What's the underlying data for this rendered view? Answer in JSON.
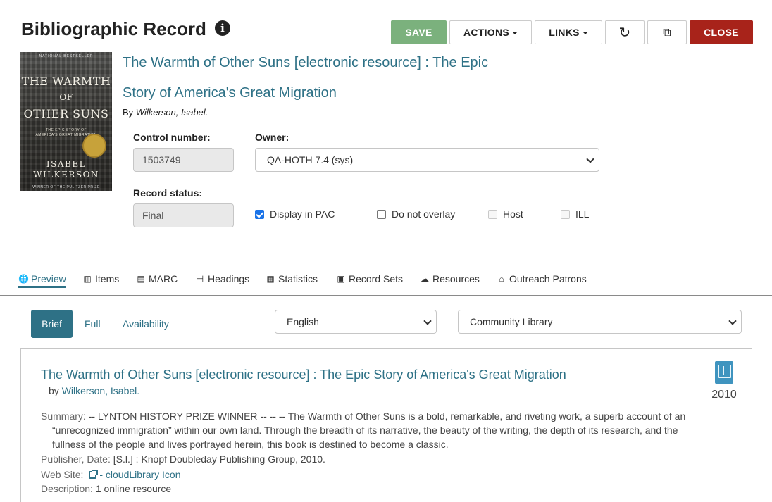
{
  "header": {
    "title": "Bibliographic Record",
    "info_glyph": "i"
  },
  "toolbar": {
    "save_label": "SAVE",
    "actions_label": "ACTIONS",
    "links_label": "LINKS",
    "refresh_glyph": "↻",
    "popout_glyph": "⧉",
    "close_label": "CLOSE"
  },
  "cover": {
    "top_text": "NATIONAL BESTSELLER",
    "title_line1": "THE WARMTH",
    "title_line2": "OF",
    "title_line3": "OTHER SUNS",
    "subtitle_line1": "THE EPIC STORY OF",
    "subtitle_line2": "AMERICA'S GREAT MIGRATION",
    "author_line1": "ISABEL",
    "author_line2": "WILKERSON",
    "footer_text": "WINNER OF THE PULITZER PRIZE"
  },
  "record": {
    "title": "The Warmth of Other Suns [electronic resource] : The Epic Story of America's Great Migration",
    "by_prefix": "By ",
    "author": "Wilkerson, Isabel."
  },
  "fields": {
    "control_number_label": "Control number:",
    "control_number_value": "1503749",
    "owner_label": "Owner:",
    "owner_value": "QA-HOTH 7.4 (sys)",
    "record_status_label": "Record status:",
    "record_status_value": "Final"
  },
  "checkboxes": {
    "display_in_pac": "Display in PAC",
    "do_not_overlay": "Do not overlay",
    "host": "Host",
    "ill": "ILL"
  },
  "tabs": [
    {
      "label": "Preview",
      "icon": "🌐"
    },
    {
      "label": "Items",
      "icon": "▥"
    },
    {
      "label": "MARC",
      "icon": "▤"
    },
    {
      "label": "Headings",
      "icon": "⊣"
    },
    {
      "label": "Statistics",
      "icon": "▦"
    },
    {
      "label": "Record Sets",
      "icon": "▣"
    },
    {
      "label": "Resources",
      "icon": "☁"
    },
    {
      "label": "Outreach Patrons",
      "icon": "⌂"
    }
  ],
  "subtabs": {
    "brief": "Brief",
    "full": "Full",
    "availability": "Availability"
  },
  "selects": {
    "language": "English",
    "library": "Community Library"
  },
  "preview": {
    "title": "The Warmth of Other Suns [electronic resource] : The Epic Story of America's Great Migration",
    "by_prefix": "by ",
    "author": "Wilkerson, Isabel.",
    "year": "2010",
    "summary_label": "Summary: ",
    "summary_line1": "-- LYNTON HISTORY PRIZE WINNER --     -- -- The Warmth of Other Suns is a bold, remarkable, and riveting work, a superb account of an",
    "summary_line2": "“unrecognized immigration” within our own land. Through the breadth of its narrative, the beauty of the writing, the depth of its research, and the",
    "summary_line3": "fullness of the people and lives portrayed herein, this book is destined to become a classic.",
    "publisher_label": "Publisher, Date: ",
    "publisher_value": "[S.l.] : Knopf Doubleday Publishing Group, 2010.",
    "website_label": "Web Site: ",
    "website_link": "- cloudLibrary Icon",
    "description_label": "Description: ",
    "description_value": "1 online resource"
  }
}
